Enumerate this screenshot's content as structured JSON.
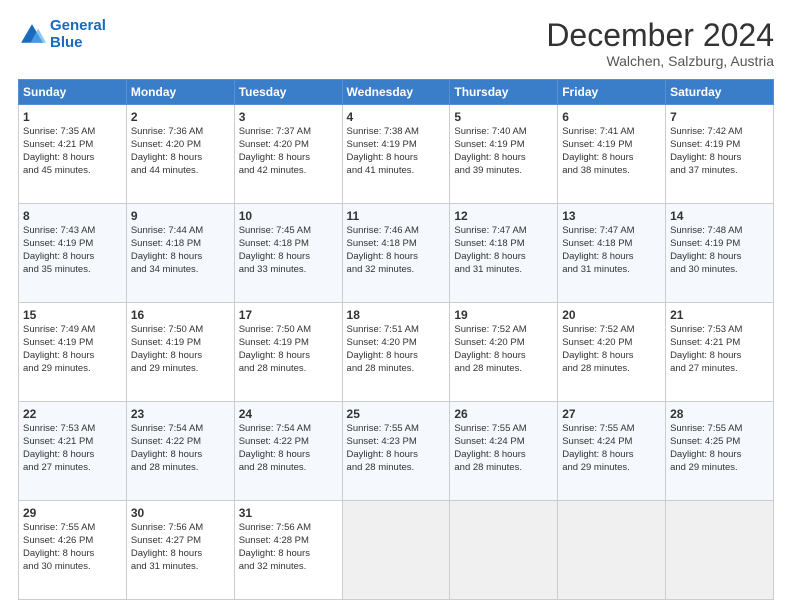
{
  "logo": {
    "line1": "General",
    "line2": "Blue"
  },
  "title": "December 2024",
  "subtitle": "Walchen, Salzburg, Austria",
  "header_days": [
    "Sunday",
    "Monday",
    "Tuesday",
    "Wednesday",
    "Thursday",
    "Friday",
    "Saturday"
  ],
  "weeks": [
    [
      {
        "day": "1",
        "lines": [
          "Sunrise: 7:35 AM",
          "Sunset: 4:21 PM",
          "Daylight: 8 hours",
          "and 45 minutes."
        ]
      },
      {
        "day": "2",
        "lines": [
          "Sunrise: 7:36 AM",
          "Sunset: 4:20 PM",
          "Daylight: 8 hours",
          "and 44 minutes."
        ]
      },
      {
        "day": "3",
        "lines": [
          "Sunrise: 7:37 AM",
          "Sunset: 4:20 PM",
          "Daylight: 8 hours",
          "and 42 minutes."
        ]
      },
      {
        "day": "4",
        "lines": [
          "Sunrise: 7:38 AM",
          "Sunset: 4:19 PM",
          "Daylight: 8 hours",
          "and 41 minutes."
        ]
      },
      {
        "day": "5",
        "lines": [
          "Sunrise: 7:40 AM",
          "Sunset: 4:19 PM",
          "Daylight: 8 hours",
          "and 39 minutes."
        ]
      },
      {
        "day": "6",
        "lines": [
          "Sunrise: 7:41 AM",
          "Sunset: 4:19 PM",
          "Daylight: 8 hours",
          "and 38 minutes."
        ]
      },
      {
        "day": "7",
        "lines": [
          "Sunrise: 7:42 AM",
          "Sunset: 4:19 PM",
          "Daylight: 8 hours",
          "and 37 minutes."
        ]
      }
    ],
    [
      {
        "day": "8",
        "lines": [
          "Sunrise: 7:43 AM",
          "Sunset: 4:19 PM",
          "Daylight: 8 hours",
          "and 35 minutes."
        ]
      },
      {
        "day": "9",
        "lines": [
          "Sunrise: 7:44 AM",
          "Sunset: 4:18 PM",
          "Daylight: 8 hours",
          "and 34 minutes."
        ]
      },
      {
        "day": "10",
        "lines": [
          "Sunrise: 7:45 AM",
          "Sunset: 4:18 PM",
          "Daylight: 8 hours",
          "and 33 minutes."
        ]
      },
      {
        "day": "11",
        "lines": [
          "Sunrise: 7:46 AM",
          "Sunset: 4:18 PM",
          "Daylight: 8 hours",
          "and 32 minutes."
        ]
      },
      {
        "day": "12",
        "lines": [
          "Sunrise: 7:47 AM",
          "Sunset: 4:18 PM",
          "Daylight: 8 hours",
          "and 31 minutes."
        ]
      },
      {
        "day": "13",
        "lines": [
          "Sunrise: 7:47 AM",
          "Sunset: 4:18 PM",
          "Daylight: 8 hours",
          "and 31 minutes."
        ]
      },
      {
        "day": "14",
        "lines": [
          "Sunrise: 7:48 AM",
          "Sunset: 4:19 PM",
          "Daylight: 8 hours",
          "and 30 minutes."
        ]
      }
    ],
    [
      {
        "day": "15",
        "lines": [
          "Sunrise: 7:49 AM",
          "Sunset: 4:19 PM",
          "Daylight: 8 hours",
          "and 29 minutes."
        ]
      },
      {
        "day": "16",
        "lines": [
          "Sunrise: 7:50 AM",
          "Sunset: 4:19 PM",
          "Daylight: 8 hours",
          "and 29 minutes."
        ]
      },
      {
        "day": "17",
        "lines": [
          "Sunrise: 7:50 AM",
          "Sunset: 4:19 PM",
          "Daylight: 8 hours",
          "and 28 minutes."
        ]
      },
      {
        "day": "18",
        "lines": [
          "Sunrise: 7:51 AM",
          "Sunset: 4:20 PM",
          "Daylight: 8 hours",
          "and 28 minutes."
        ]
      },
      {
        "day": "19",
        "lines": [
          "Sunrise: 7:52 AM",
          "Sunset: 4:20 PM",
          "Daylight: 8 hours",
          "and 28 minutes."
        ]
      },
      {
        "day": "20",
        "lines": [
          "Sunrise: 7:52 AM",
          "Sunset: 4:20 PM",
          "Daylight: 8 hours",
          "and 28 minutes."
        ]
      },
      {
        "day": "21",
        "lines": [
          "Sunrise: 7:53 AM",
          "Sunset: 4:21 PM",
          "Daylight: 8 hours",
          "and 27 minutes."
        ]
      }
    ],
    [
      {
        "day": "22",
        "lines": [
          "Sunrise: 7:53 AM",
          "Sunset: 4:21 PM",
          "Daylight: 8 hours",
          "and 27 minutes."
        ]
      },
      {
        "day": "23",
        "lines": [
          "Sunrise: 7:54 AM",
          "Sunset: 4:22 PM",
          "Daylight: 8 hours",
          "and 28 minutes."
        ]
      },
      {
        "day": "24",
        "lines": [
          "Sunrise: 7:54 AM",
          "Sunset: 4:22 PM",
          "Daylight: 8 hours",
          "and 28 minutes."
        ]
      },
      {
        "day": "25",
        "lines": [
          "Sunrise: 7:55 AM",
          "Sunset: 4:23 PM",
          "Daylight: 8 hours",
          "and 28 minutes."
        ]
      },
      {
        "day": "26",
        "lines": [
          "Sunrise: 7:55 AM",
          "Sunset: 4:24 PM",
          "Daylight: 8 hours",
          "and 28 minutes."
        ]
      },
      {
        "day": "27",
        "lines": [
          "Sunrise: 7:55 AM",
          "Sunset: 4:24 PM",
          "Daylight: 8 hours",
          "and 29 minutes."
        ]
      },
      {
        "day": "28",
        "lines": [
          "Sunrise: 7:55 AM",
          "Sunset: 4:25 PM",
          "Daylight: 8 hours",
          "and 29 minutes."
        ]
      }
    ],
    [
      {
        "day": "29",
        "lines": [
          "Sunrise: 7:55 AM",
          "Sunset: 4:26 PM",
          "Daylight: 8 hours",
          "and 30 minutes."
        ]
      },
      {
        "day": "30",
        "lines": [
          "Sunrise: 7:56 AM",
          "Sunset: 4:27 PM",
          "Daylight: 8 hours",
          "and 31 minutes."
        ]
      },
      {
        "day": "31",
        "lines": [
          "Sunrise: 7:56 AM",
          "Sunset: 4:28 PM",
          "Daylight: 8 hours",
          "and 32 minutes."
        ]
      },
      null,
      null,
      null,
      null
    ]
  ]
}
